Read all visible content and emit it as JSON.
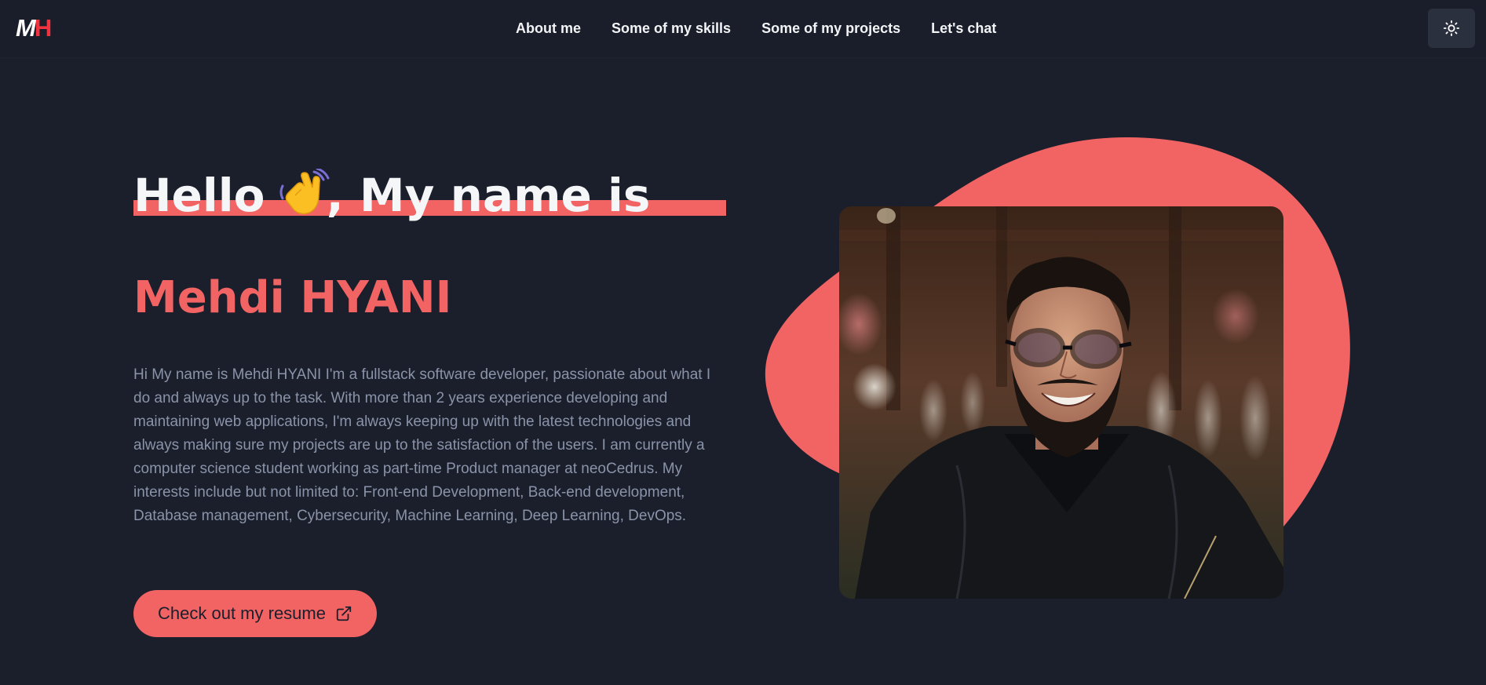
{
  "logo": {
    "m": "M",
    "h": "H"
  },
  "nav": {
    "links": [
      {
        "label": "About me"
      },
      {
        "label": "Some of my skills"
      },
      {
        "label": "Some of my projects"
      },
      {
        "label": "Let's chat"
      }
    ]
  },
  "theme_toggle": {
    "icon": "sun-icon"
  },
  "hero": {
    "greeting_hello": "Hello",
    "greeting_emoji": "waving-hand-icon",
    "greeting_rest": ", My name is",
    "name": "Mehdi HYANI",
    "bio": "Hi My name is Mehdi HYANI I'm a fullstack software developer, passionate about what I do and always up to the task. With more than 2 years experience developing and maintaining web applications, I'm always keeping up with the latest technologies and always making sure my projects are up to the satisfaction of the users. I am currently a computer science student working as part-time Product manager at neoCedrus. My interests include but not limited to: Front-end Development, Back-end development, Database management, Cybersecurity, Machine Learning, Deep Learning, DevOps.",
    "resume_button_label": "Check out my resume",
    "resume_icon": "external-link-icon"
  },
  "colors": {
    "background": "#1b1f2c",
    "accent": "#f26464",
    "logo_h": "#f0333f",
    "text_muted": "#8a93a8"
  }
}
